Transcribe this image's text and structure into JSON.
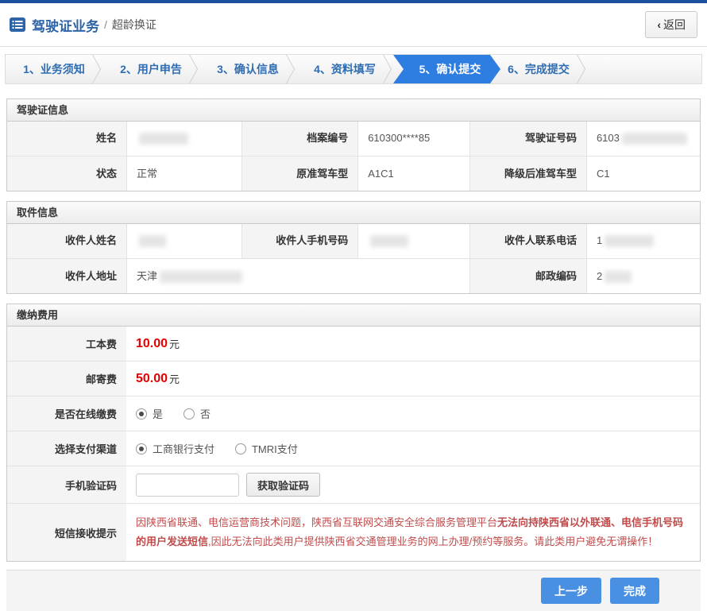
{
  "colors": {
    "top_strip": "#1c4f9e",
    "accent_blue": "#2d64a8",
    "active_step_blue": "#2e7de1",
    "button_blue": "#4a90e2",
    "fee_red": "#e60000",
    "notice_red": "#c14b4b"
  },
  "header": {
    "title": "驾驶证业务",
    "separator": "/",
    "subtitle": "超龄换证",
    "back_icon": "‹",
    "back_label": "返回"
  },
  "steps": [
    {
      "label": "1、业务须知",
      "active": false
    },
    {
      "label": "2、用户申告",
      "active": false
    },
    {
      "label": "3、确认信息",
      "active": false
    },
    {
      "label": "4、资料填写",
      "active": false
    },
    {
      "label": "5、确认提交",
      "active": true
    },
    {
      "label": "6、完成提交",
      "active": false
    }
  ],
  "license_info": {
    "title": "驾驶证信息",
    "rows": [
      [
        {
          "label": "姓名",
          "value": "",
          "redacted": true
        },
        {
          "label": "档案编号",
          "value": "610300****85",
          "redacted": false
        },
        {
          "label": "驾驶证号码",
          "value": "6103",
          "redacted": true
        }
      ],
      [
        {
          "label": "状态",
          "value": "正常",
          "redacted": false
        },
        {
          "label": "原准驾车型",
          "value": "A1C1",
          "redacted": false
        },
        {
          "label": "降级后准驾车型",
          "value": "C1",
          "redacted": false
        }
      ]
    ]
  },
  "pickup_info": {
    "title": "取件信息",
    "rows": [
      [
        {
          "label": "收件人姓名",
          "value": "",
          "redacted": true
        },
        {
          "label": "收件人手机号码",
          "value": "",
          "redacted": true
        },
        {
          "label": "收件人联系电话",
          "value": "1",
          "redacted": true
        }
      ],
      [
        {
          "label": "收件人地址",
          "value": "天津",
          "redacted": true
        },
        {
          "label": "邮政编码",
          "value": "2",
          "redacted": true
        }
      ]
    ]
  },
  "payment": {
    "title": "缴纳费用",
    "fee_rows": [
      {
        "label": "工本费",
        "amount": "10.00",
        "unit": "元"
      },
      {
        "label": "邮寄费",
        "amount": "50.00",
        "unit": "元"
      }
    ],
    "online_pay": {
      "label": "是否在线缴费",
      "options": [
        {
          "label": "是",
          "checked": true
        },
        {
          "label": "否",
          "checked": false
        }
      ]
    },
    "channel": {
      "label": "选择支付渠道",
      "options": [
        {
          "label": "工商银行支付",
          "checked": true
        },
        {
          "label": "TMRI支付",
          "checked": false
        }
      ]
    },
    "sms_code": {
      "label": "手机验证码",
      "input_value": "",
      "button_label": "获取验证码"
    },
    "notice": {
      "label": "短信接收提示",
      "segments": [
        "因陕西省联通、电信运营商技术问题，陕西省互联网交通安全综合服务管理平台",
        "无法向持陕西省以外联通、电信手机号码的用户发送短信",
        ",因此无法向此类用户提供陕西省交通管理业务的网上办理/预约等服务。请此类用户避免无谓操作！"
      ]
    }
  },
  "footer": {
    "prev_label": "上一步",
    "finish_label": "完成"
  }
}
